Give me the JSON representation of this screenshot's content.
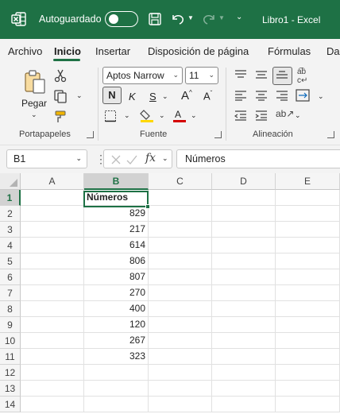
{
  "titlebar": {
    "autosave_label": "Autoguardado",
    "autosave_on": false,
    "document_title": "Libro1  -  Excel",
    "color": "#1e7145"
  },
  "tabs": [
    "Archivo",
    "Inicio",
    "Insertar",
    "Disposición de página",
    "Fórmulas",
    "Da"
  ],
  "active_tab": "Inicio",
  "ribbon": {
    "clipboard": {
      "paste_label": "Pegar",
      "group_label": "Portapapeles"
    },
    "font": {
      "font_name": "Aptos Narrow",
      "font_size": "11",
      "bold": "N",
      "italic": "K",
      "underline": "S",
      "group_label": "Fuente",
      "fill_color": "#ffd800",
      "font_color": "#d40000"
    },
    "alignment": {
      "group_label": "Alineación"
    }
  },
  "formula_bar": {
    "name_box": "B1",
    "fx_label": "fx",
    "content": "Números"
  },
  "sheet": {
    "columns": [
      "A",
      "B",
      "C",
      "D",
      "E"
    ],
    "selected_column": "B",
    "rows": [
      "1",
      "2",
      "3",
      "4",
      "5",
      "6",
      "7",
      "8",
      "9",
      "10",
      "11",
      "12",
      "13",
      "14"
    ],
    "selected_row": "1",
    "header_cell": "Números",
    "values": [
      "829",
      "217",
      "614",
      "806",
      "807",
      "270",
      "400",
      "120",
      "267",
      "323"
    ]
  }
}
